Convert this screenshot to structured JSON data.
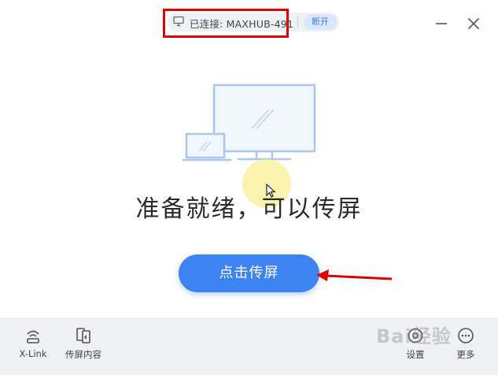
{
  "header": {
    "connection_icon": "monitor-icon",
    "connection_status": "已连接: MAXHUB-491",
    "disconnect_label": "断开",
    "minimize_icon": "minimize-icon",
    "close_icon": "close-icon"
  },
  "main": {
    "illustration": "laptop-and-monitor-illustration",
    "ready_text": "准备就绪，可以传屏",
    "cast_button_label": "点击传屏"
  },
  "toolbar": {
    "items": [
      {
        "label": "X-Link",
        "icon": "xlink-icon"
      },
      {
        "label": "传屏内容",
        "icon": "cast-content-icon"
      },
      {
        "label": "设置",
        "icon": "settings-icon"
      },
      {
        "label": "更多",
        "icon": "more-icon"
      }
    ]
  },
  "watermark": "Bai经验",
  "colors": {
    "accent": "#3d83f2",
    "annotation_red": "#e00000",
    "illustration_blue": "#a9c6f5"
  }
}
